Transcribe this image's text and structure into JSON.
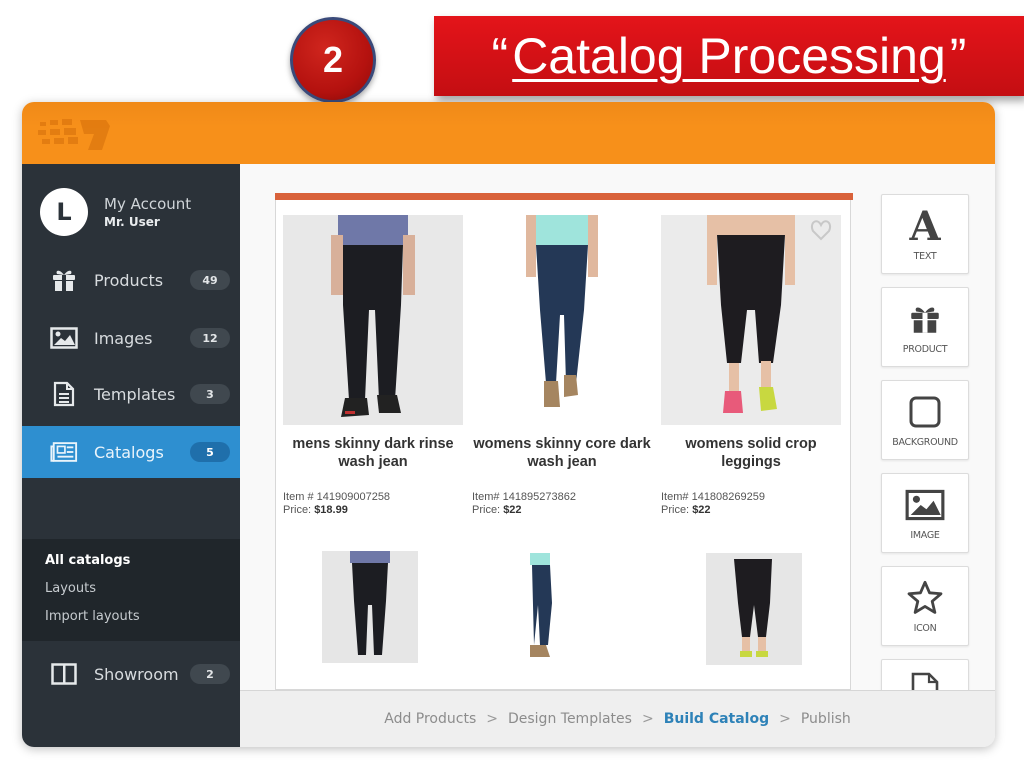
{
  "slide": {
    "step_number": "2",
    "title_open_quote": "“",
    "title": "Catalog Processing",
    "title_close_quote": "”"
  },
  "colors": {
    "topbar": "#f7901a",
    "sidebar": "#2b3239",
    "active": "#2e8fd0",
    "banner": "#e4141a",
    "page_accent": "#d9623b",
    "current_step": "#2e82b8"
  },
  "account": {
    "avatar_letter": "L",
    "title": "My Account",
    "user": "Mr. User"
  },
  "sidebar": {
    "items": [
      {
        "label": "Products",
        "count": "49",
        "icon": "gift-icon"
      },
      {
        "label": "Images",
        "count": "12",
        "icon": "image-icon"
      },
      {
        "label": "Templates",
        "count": "3",
        "icon": "document-icon"
      },
      {
        "label": "Catalogs",
        "count": "5",
        "icon": "catalog-icon",
        "active": true
      },
      {
        "label": "Showroom",
        "count": "2",
        "icon": "columns-icon"
      }
    ],
    "subitems": [
      {
        "label": "All catalogs",
        "selected": true
      },
      {
        "label": "Layouts"
      },
      {
        "label": "Import layouts"
      }
    ]
  },
  "products": [
    {
      "name": "mens skinny dark rinse wash jean",
      "item_label": "Item #",
      "item": "141909007258",
      "price_label": "Price:",
      "price": "$18.99"
    },
    {
      "name": "womens skinny core dark wash jean",
      "item_label": "Item#",
      "item": "141895273862",
      "price_label": "Price:",
      "price": "$22"
    },
    {
      "name": "womens solid crop leggings",
      "item_label": "Item#",
      "item": "141808269259",
      "price_label": "Price:",
      "price": "$22"
    }
  ],
  "tools": [
    {
      "label": "TEXT",
      "icon": "text-icon"
    },
    {
      "label": "PRODUCT",
      "icon": "gift-icon"
    },
    {
      "label": "BACKGROUND",
      "icon": "square-icon"
    },
    {
      "label": "IMAGE",
      "icon": "image-icon"
    },
    {
      "label": "ICON",
      "icon": "star-icon"
    },
    {
      "label": "",
      "icon": "page-icon"
    }
  ],
  "wizard": {
    "steps": [
      "Add Products",
      "Design Templates",
      "Build Catalog",
      "Publish"
    ],
    "current": "Build Catalog",
    "separator": ">"
  }
}
